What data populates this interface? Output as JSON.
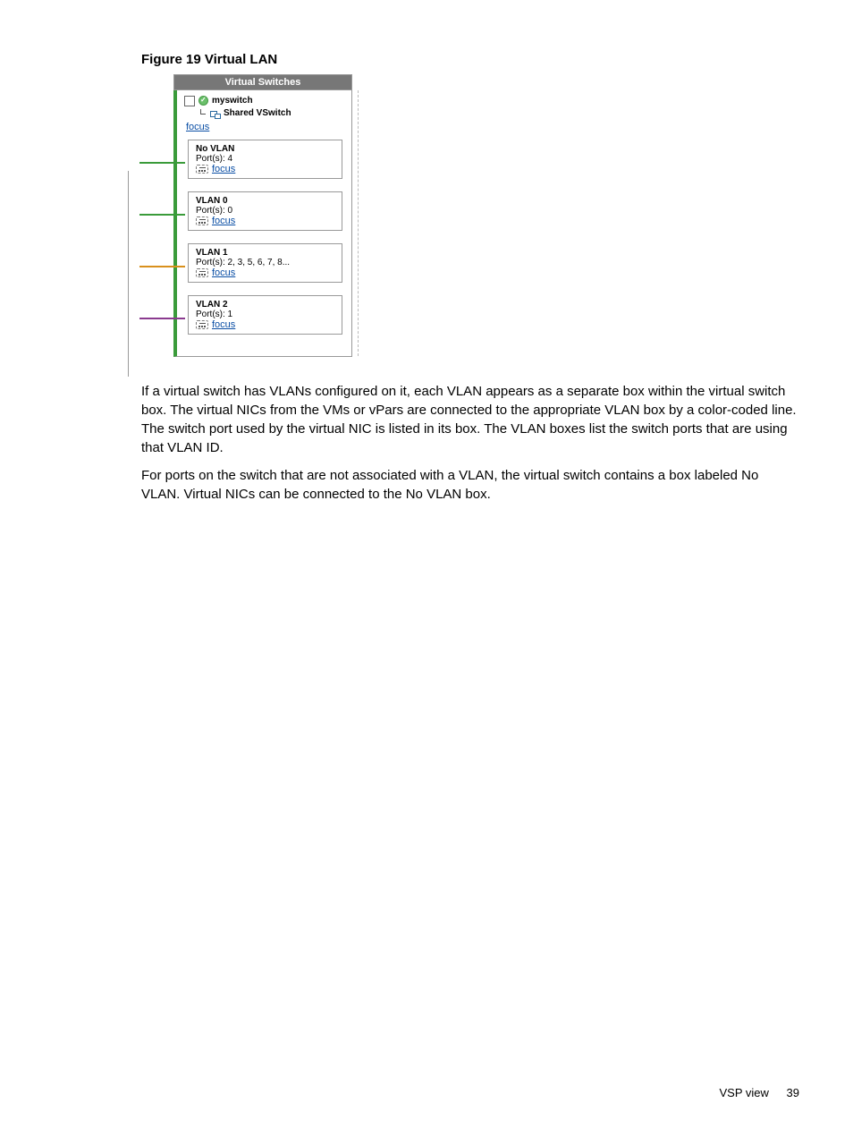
{
  "figure": {
    "caption": "Figure 19 Virtual LAN",
    "panel_title": "Virtual Switches",
    "switch_name": "myswitch",
    "switch_subtitle": "Shared VSwitch",
    "focus": "focus",
    "vlans": [
      {
        "title": "No VLAN",
        "ports": "Port(s): 4"
      },
      {
        "title": "VLAN 0",
        "ports": "Port(s): 0"
      },
      {
        "title": "VLAN 1",
        "ports": "Port(s): 2, 3, 5, 6, 7, 8..."
      },
      {
        "title": "VLAN 2",
        "ports": "Port(s): 1"
      }
    ]
  },
  "paragraphs": {
    "p1": "If a virtual switch has VLANs configured on it, each VLAN appears as a separate box within the virtual switch box. The virtual NICs from the VMs or vPars are connected to the appropriate VLAN box by a color-coded line. The switch port used by the virtual NIC is listed in its box. The VLAN boxes list the switch ports that are using that VLAN ID.",
    "p2": "For ports on the switch that are not associated with a VLAN, the virtual switch contains a box labeled No VLAN. Virtual NICs can be connected to the No VLAN box."
  },
  "footer": {
    "section": "VSP view",
    "page": "39"
  }
}
